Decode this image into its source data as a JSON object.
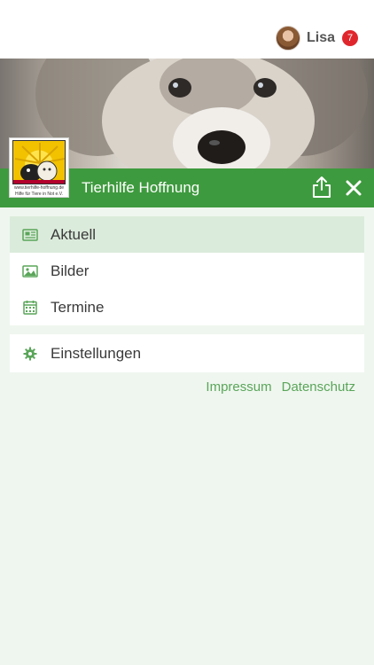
{
  "user": {
    "name": "Lisa",
    "notification_count": "7"
  },
  "header": {
    "title": "Tierhilfe Hoffnung"
  },
  "logo": {
    "lines": [
      "www.tierhilfe-hoffnung.de",
      "Hilfe für Tiere in Not e.V."
    ]
  },
  "menu": {
    "items": [
      {
        "label": "Aktuell",
        "icon": "newspaper-icon",
        "active": true
      },
      {
        "label": "Bilder",
        "icon": "image-icon",
        "active": false
      },
      {
        "label": "Termine",
        "icon": "calendar-icon",
        "active": false
      }
    ],
    "settings": {
      "label": "Einstellungen",
      "icon": "gear-icon"
    }
  },
  "footer": {
    "impressum": "Impressum",
    "datenschutz": "Datenschutz"
  },
  "colors": {
    "accent": "#3e9a3e",
    "active_bg": "#dbebdb",
    "link": "#5aa55a",
    "badge": "#e0262d",
    "background": "#eff6ef"
  }
}
